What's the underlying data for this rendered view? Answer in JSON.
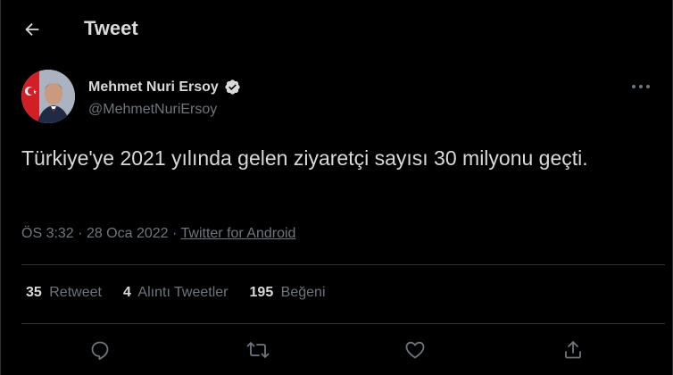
{
  "header": {
    "title": "Tweet",
    "back_icon": "arrow-left-icon"
  },
  "author": {
    "name": "Mehmet Nuri Ersoy",
    "handle": "@MehmetNuriErsoy",
    "verified_icon": "verified-badge-icon",
    "avatar": "profile-photo"
  },
  "tweet": {
    "text": "Türkiye'ye 2021 yılında gelen ziyaretçi sayısı 30 milyonu geçti.",
    "time": "ÖS 3:32",
    "date": "28 Oca 2022",
    "source": "Twitter for Android",
    "separator": "·"
  },
  "stats": {
    "retweets": {
      "count": "35",
      "label": "Retweet"
    },
    "quotes": {
      "count": "4",
      "label": "Alıntı Tweetler"
    },
    "likes": {
      "count": "195",
      "label": "Beğeni"
    }
  },
  "actions": [
    "reply-icon",
    "retweet-icon",
    "like-icon",
    "share-icon"
  ],
  "colors": {
    "background": "#000000",
    "text": "#d9d9d9",
    "secondary": "#6e767d",
    "divider": "#2f3336",
    "verified": "#d9d9d9"
  }
}
